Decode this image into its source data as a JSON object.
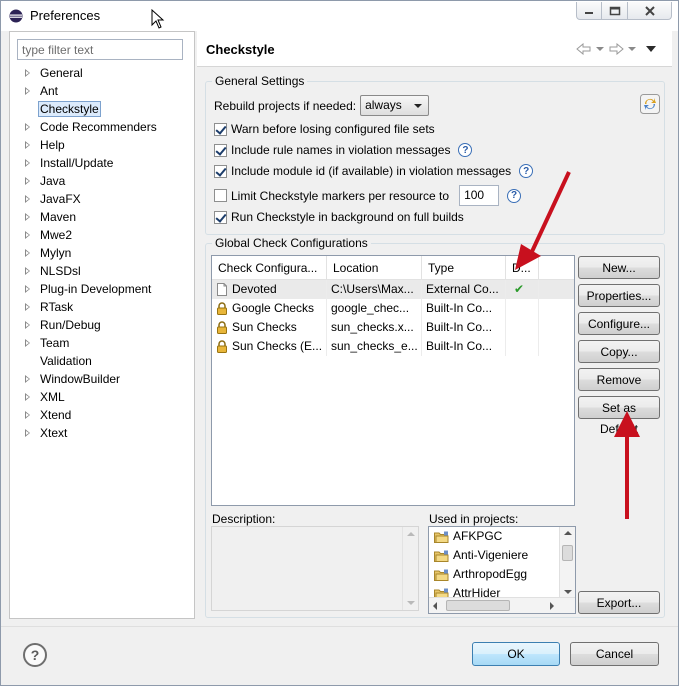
{
  "window": {
    "title": "Preferences",
    "icon": "eclipse-icon"
  },
  "filter": {
    "placeholder": "type filter text",
    "value": ""
  },
  "tree": [
    {
      "label": "General",
      "expandable": true
    },
    {
      "label": "Ant",
      "expandable": true
    },
    {
      "label": "Checkstyle",
      "expandable": false,
      "selected": true
    },
    {
      "label": "Code Recommenders",
      "expandable": true
    },
    {
      "label": "Help",
      "expandable": true
    },
    {
      "label": "Install/Update",
      "expandable": true
    },
    {
      "label": "Java",
      "expandable": true
    },
    {
      "label": "JavaFX",
      "expandable": true
    },
    {
      "label": "Maven",
      "expandable": true
    },
    {
      "label": "Mwe2",
      "expandable": true
    },
    {
      "label": "Mylyn",
      "expandable": true
    },
    {
      "label": "NLSDsl",
      "expandable": true
    },
    {
      "label": "Plug-in Development",
      "expandable": true
    },
    {
      "label": "RTask",
      "expandable": true
    },
    {
      "label": "Run/Debug",
      "expandable": true
    },
    {
      "label": "Team",
      "expandable": true
    },
    {
      "label": "Validation",
      "expandable": false
    },
    {
      "label": "WindowBuilder",
      "expandable": true
    },
    {
      "label": "XML",
      "expandable": true
    },
    {
      "label": "Xtend",
      "expandable": true
    },
    {
      "label": "Xtext",
      "expandable": true
    }
  ],
  "page": {
    "title": "Checkstyle",
    "general": {
      "title": "General Settings",
      "rebuild_label": "Rebuild projects if needed:",
      "rebuild_value": "always",
      "opt_warn": "Warn before losing configured file sets",
      "opt_rule_names": "Include rule names in violation messages",
      "opt_module_id": "Include module id (if available) in violation messages",
      "opt_limit": "Limit Checkstyle markers per resource to",
      "limit_value": "100",
      "opt_background": "Run Checkstyle in background on full builds",
      "checked": [
        true,
        true,
        true,
        false,
        true
      ]
    },
    "global": {
      "title": "Global Check Configurations",
      "columns": [
        "Check Configura...",
        "Location",
        "Type",
        "D..."
      ],
      "rows": [
        {
          "name": "Devoted",
          "location": "C:\\Users\\Max...",
          "type": "External Co...",
          "default": "✔",
          "icon": "file-icon"
        },
        {
          "name": "Google Checks",
          "location": "google_chec...",
          "type": "Built-In Co...",
          "default": "",
          "icon": "lock-icon"
        },
        {
          "name": "Sun Checks",
          "location": "sun_checks.x...",
          "type": "Built-In Co...",
          "default": "",
          "icon": "lock-icon"
        },
        {
          "name": "Sun Checks (E...",
          "location": "sun_checks_e...",
          "type": "Built-In Co...",
          "default": "",
          "icon": "lock-icon"
        }
      ],
      "buttons": {
        "new": "New...",
        "properties": "Properties...",
        "configure": "Configure...",
        "copy": "Copy...",
        "remove": "Remove",
        "set_default": "Set as Default",
        "export": "Export..."
      },
      "description_label": "Description:",
      "used_label": "Used in projects:",
      "projects": [
        "AFKPGC",
        "Anti-Vigeniere",
        "ArthropodEgg",
        "AttrHider"
      ]
    }
  },
  "footer": {
    "ok": "OK",
    "cancel": "Cancel",
    "help": "?"
  },
  "colors": {
    "accent_arrow": "#c8101e",
    "check_green": "#2a9a2a"
  }
}
